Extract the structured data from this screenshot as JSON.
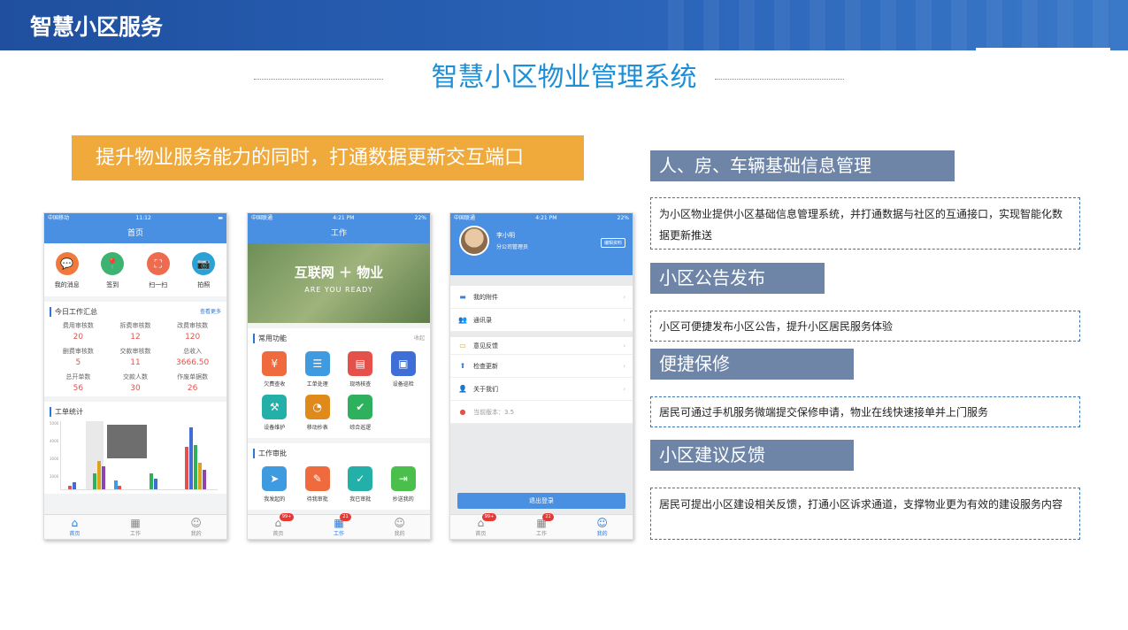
{
  "header": {
    "title": "智慧小区服务"
  },
  "main_title": "智慧小区物业管理系统",
  "banner": "提升物业服务能力的同时，打通数据更新交互端口",
  "phone1": {
    "carrier": "中国移动",
    "time": "11:12",
    "title": "首页",
    "quick": [
      {
        "label": "我的消息",
        "icon": "message-icon",
        "color": "#f07a3d",
        "glyph": "💬"
      },
      {
        "label": "签到",
        "icon": "checkin-icon",
        "color": "#3cb371",
        "glyph": "📍"
      },
      {
        "label": "扫一扫",
        "icon": "scan-icon",
        "color": "#ef6b50",
        "glyph": "⛶"
      },
      {
        "label": "拍照",
        "icon": "camera-icon",
        "color": "#2aa2d6",
        "glyph": "📷"
      }
    ],
    "summary_title": "今日工作汇总",
    "summary_more": "查看更多",
    "stats": [
      {
        "label": "费用审核数",
        "value": "20"
      },
      {
        "label": "拆费审核数",
        "value": "12"
      },
      {
        "label": "改费审核数",
        "value": "120"
      },
      {
        "label": "删费审核数",
        "value": "5"
      },
      {
        "label": "交款审核数",
        "value": "11"
      },
      {
        "label": "总收入",
        "value": "3666.50"
      },
      {
        "label": "总开单数",
        "value": "56"
      },
      {
        "label": "交款人数",
        "value": "30"
      },
      {
        "label": "作废单据数",
        "value": "26"
      }
    ],
    "stats_title": "工单统计",
    "chart_axis": [
      "5000",
      "4000",
      "3000",
      "2000"
    ],
    "tabs": [
      {
        "label": "首页",
        "icon": "home-icon",
        "glyph": "⌂",
        "active": true
      },
      {
        "label": "工作",
        "icon": "work-icon",
        "glyph": "▦"
      },
      {
        "label": "我的",
        "icon": "profile-icon",
        "glyph": "☺"
      }
    ]
  },
  "phone2": {
    "carrier": "中国联通",
    "time": "4:21 PM",
    "battery": "22%",
    "title": "工作",
    "hero_title": "互联网 ＋ 物业",
    "hero_sub": "ARE YOU READY",
    "common_title": "常用功能",
    "common_more": "收起",
    "functions": [
      {
        "label": "欠费查收",
        "icon": "yuan-icon",
        "color": "#ef6b3d",
        "glyph": "¥"
      },
      {
        "label": "工单处理",
        "icon": "clipboard-icon",
        "color": "#3f9be0",
        "glyph": "☰"
      },
      {
        "label": "现场核查",
        "icon": "document-icon",
        "color": "#e5514a",
        "glyph": "▤"
      },
      {
        "label": "设备巡检",
        "icon": "chart-icon",
        "color": "#3f6fd6",
        "glyph": "▣"
      },
      {
        "label": "设备维护",
        "icon": "maintenance-icon",
        "color": "#22b0a8",
        "glyph": "⚒"
      },
      {
        "label": "移动抄表",
        "icon": "meter-icon",
        "color": "#e08a1c",
        "glyph": "◔"
      },
      {
        "label": "综合巡逻",
        "icon": "shield-icon",
        "color": "#2db15c",
        "glyph": "✔"
      }
    ],
    "approval_title": "工作审批",
    "approvals": [
      {
        "label": "我发起的",
        "icon": "send-icon",
        "color": "#3f9be0",
        "glyph": "➤"
      },
      {
        "label": "待我审批",
        "icon": "pending-icon",
        "color": "#ef6b3d",
        "glyph": "✎"
      },
      {
        "label": "我已审批",
        "icon": "approved-icon",
        "color": "#22b0a8",
        "glyph": "✓"
      },
      {
        "label": "抄送我的",
        "icon": "cc-icon",
        "color": "#4bbf4b",
        "glyph": "⇥"
      }
    ],
    "tabs": [
      {
        "label": "首页",
        "icon": "home-icon",
        "glyph": "⌂",
        "badge": "99+"
      },
      {
        "label": "工作",
        "icon": "work-icon",
        "glyph": "▦",
        "badge": "21",
        "active": true
      },
      {
        "label": "我的",
        "icon": "profile-icon",
        "glyph": "☺"
      }
    ]
  },
  "phone3": {
    "carrier": "中国联通",
    "time": "4:21 PM",
    "battery": "22%",
    "name": "李小明",
    "role": "分公司管理员",
    "edit": "编辑资料",
    "menu": [
      {
        "label": "我的附件",
        "icon": "folder-icon",
        "glyph": "▬",
        "color": "#3f7fd6"
      },
      {
        "label": "通讯录",
        "icon": "contacts-icon",
        "glyph": "👥",
        "color": "#e0a21c"
      },
      {
        "label": "意见反馈",
        "icon": "feedback-icon",
        "glyph": "▭",
        "color": "#e0a21c"
      },
      {
        "label": "检查更新",
        "icon": "update-icon",
        "glyph": "⬆",
        "color": "#3f7fd6"
      },
      {
        "label": "关于我们",
        "icon": "about-icon",
        "glyph": "👤",
        "color": "#3f7fd6"
      }
    ],
    "version": "当前版本：3.5",
    "logout": "退出登录",
    "tabs": [
      {
        "label": "首页",
        "icon": "home-icon",
        "glyph": "⌂",
        "badge": "99+"
      },
      {
        "label": "工作",
        "icon": "work-icon",
        "glyph": "▦",
        "badge": "21"
      },
      {
        "label": "我的",
        "icon": "profile-icon",
        "glyph": "☺",
        "active": true
      }
    ]
  },
  "features": [
    {
      "title": "人、房、车辆基础信息管理",
      "desc": "为小区物业提供小区基础信息管理系统，并打通数据与社区的互通接口，实现智能化数据更新推送"
    },
    {
      "title": "小区公告发布",
      "desc": "小区可便捷发布小区公告，提升小区居民服务体验"
    },
    {
      "title": "便捷保修",
      "desc": "居民可通过手机服务微端提交保修申请，物业在线快速接单并上门服务"
    },
    {
      "title": "小区建议反馈",
      "desc": "居民可提出小区建设相关反馈，打通小区诉求通道，支撑物业更为有效的建设服务内容"
    }
  ]
}
